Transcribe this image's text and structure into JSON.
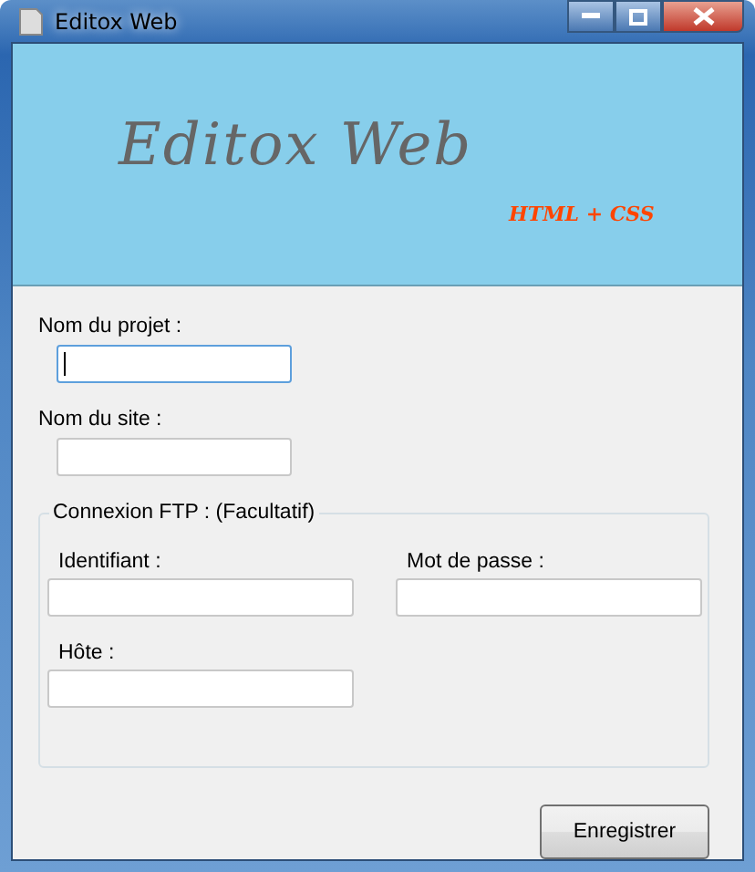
{
  "window": {
    "title": "Editox Web"
  },
  "banner": {
    "title": "Editox Web",
    "subtitle": "HTML + CSS"
  },
  "fields": [
    {
      "label": "Nom du projet :",
      "focused": true
    },
    {
      "label": "Nom du site :",
      "focused": false
    }
  ],
  "ftp_group": {
    "legend": "Connexion FTP : (Facultatif)",
    "fields": [
      {
        "label": "Identifiant :",
        "focused": false
      },
      {
        "label": "Mot de passe :",
        "focused": false
      },
      {
        "label": "Hôte :",
        "focused": false
      }
    ]
  },
  "buttons": [
    "Enregistrer"
  ]
}
